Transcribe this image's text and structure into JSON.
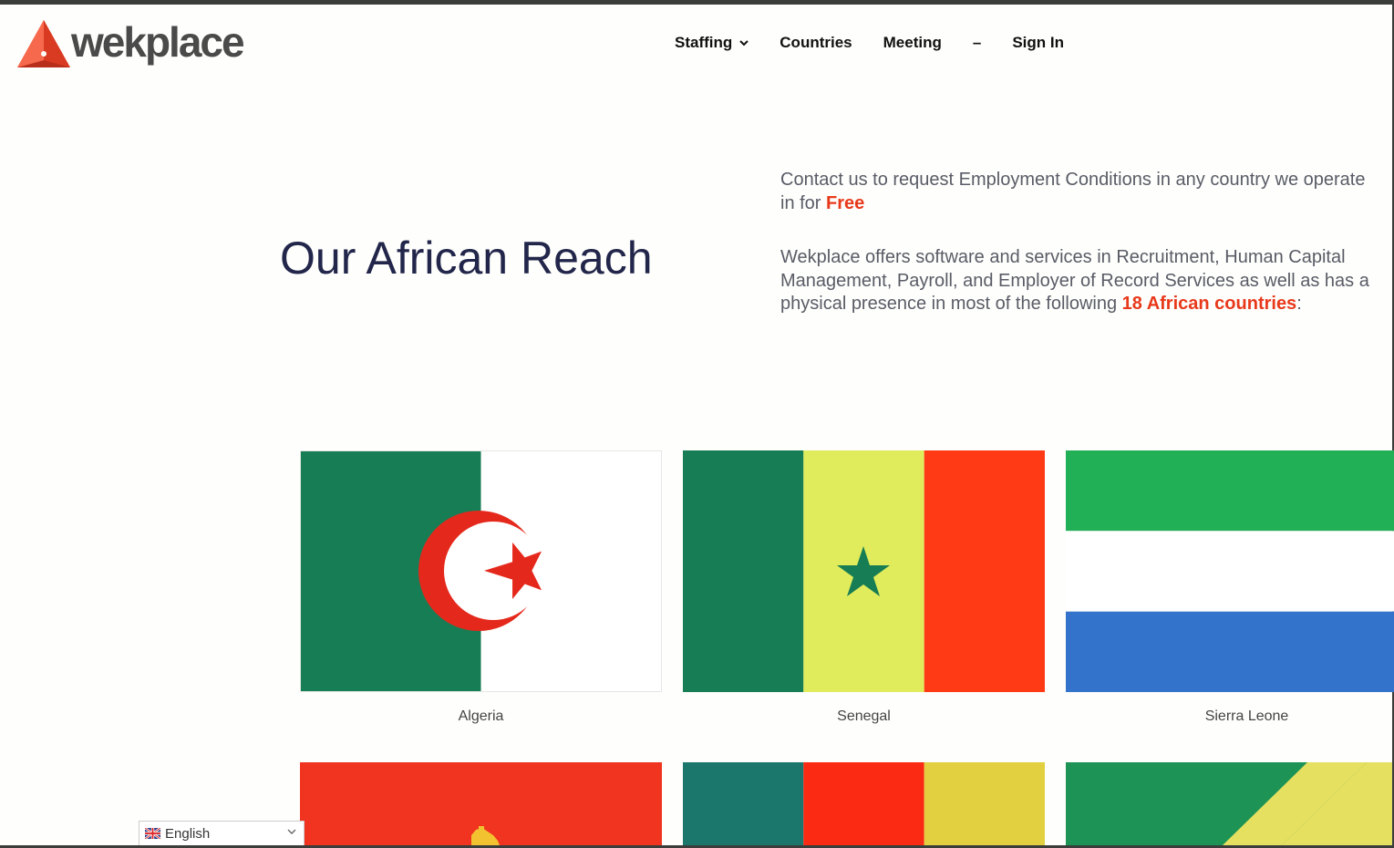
{
  "brand": {
    "name": "wekplace",
    "colors": {
      "accent": "#e8391b",
      "dark_text": "#22264a",
      "logo_gray": "#4a4a4a"
    }
  },
  "nav": {
    "items": [
      {
        "label": "Staffing",
        "has_dropdown": true
      },
      {
        "label": "Countries"
      },
      {
        "label": "Meeting"
      }
    ],
    "dash": "–",
    "signin_label": "Sign In"
  },
  "hero": {
    "title": "Our African Reach",
    "p1_text": "Contact us to request Employment Conditions in any country we operate in for ",
    "p1_highlight": "Free",
    "p2_text": "Wekplace offers software and services in Recruitment, Human Capital Management, Payroll, and Employer of Record Services as well as has a physical presence in most of the following ",
    "p2_highlight": "18 African countries",
    "p2_end": ":"
  },
  "countries": [
    {
      "name": "Algeria",
      "flag": "algeria-flag"
    },
    {
      "name": "Senegal",
      "flag": "senegal-flag"
    },
    {
      "name": "Sierra Leone",
      "flag": "sierra-leone-flag"
    },
    {
      "name": "",
      "flag": "angola-flag"
    },
    {
      "name": "",
      "flag": "guinea-flag"
    },
    {
      "name": "",
      "flag": "congo-flag"
    }
  ],
  "language": {
    "label": "English",
    "icon": "uk-flag-icon"
  }
}
